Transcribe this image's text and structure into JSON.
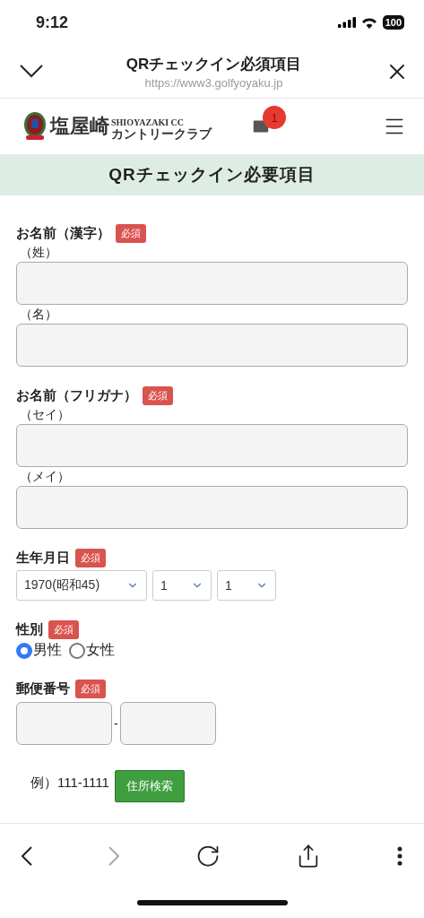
{
  "status_bar": {
    "time": "9:12",
    "battery": "100"
  },
  "browser_header": {
    "title": "QRチェックイン必須項目",
    "url": "https://www3.golfyoyaku.jp"
  },
  "site_header": {
    "logo_latin": "SHIOYAZAKI CC",
    "logo_main": "塩屋崎",
    "logo_sub": "カントリークラブ",
    "mail_count": "1"
  },
  "page_title": "QRチェックイン必要項目",
  "sections": [
    {
      "kind": "names",
      "label": "お名前（漢字）",
      "badge": "必須",
      "fields": [
        {
          "label": "（姓）"
        },
        {
          "label": "（名）"
        }
      ]
    },
    {
      "kind": "names",
      "label": "お名前（フリガナ）",
      "badge": "必須",
      "fields": [
        {
          "label": "（セイ）"
        },
        {
          "label": "（メイ）"
        }
      ]
    },
    {
      "kind": "date",
      "label": "生年月日",
      "badge": "必須",
      "selects": [
        {
          "value": "1970(昭和45)"
        },
        {
          "value": "1"
        },
        {
          "value": "1"
        }
      ]
    },
    {
      "kind": "radio",
      "label": "性別",
      "badge": "必須",
      "options": [
        {
          "label": "男性",
          "selected": true
        },
        {
          "label": "女性",
          "selected": false
        }
      ]
    },
    {
      "kind": "postal",
      "label": "郵便番号",
      "badge": "必須",
      "separator": "-",
      "example": "例）111-1111",
      "button": "住所検索"
    }
  ],
  "toolbar": [
    {
      "kind": "back",
      "disabled": false
    },
    {
      "kind": "forward",
      "disabled": true
    },
    {
      "kind": "reload",
      "disabled": false
    },
    {
      "kind": "share",
      "disabled": false
    },
    {
      "kind": "more",
      "disabled": false
    }
  ]
}
